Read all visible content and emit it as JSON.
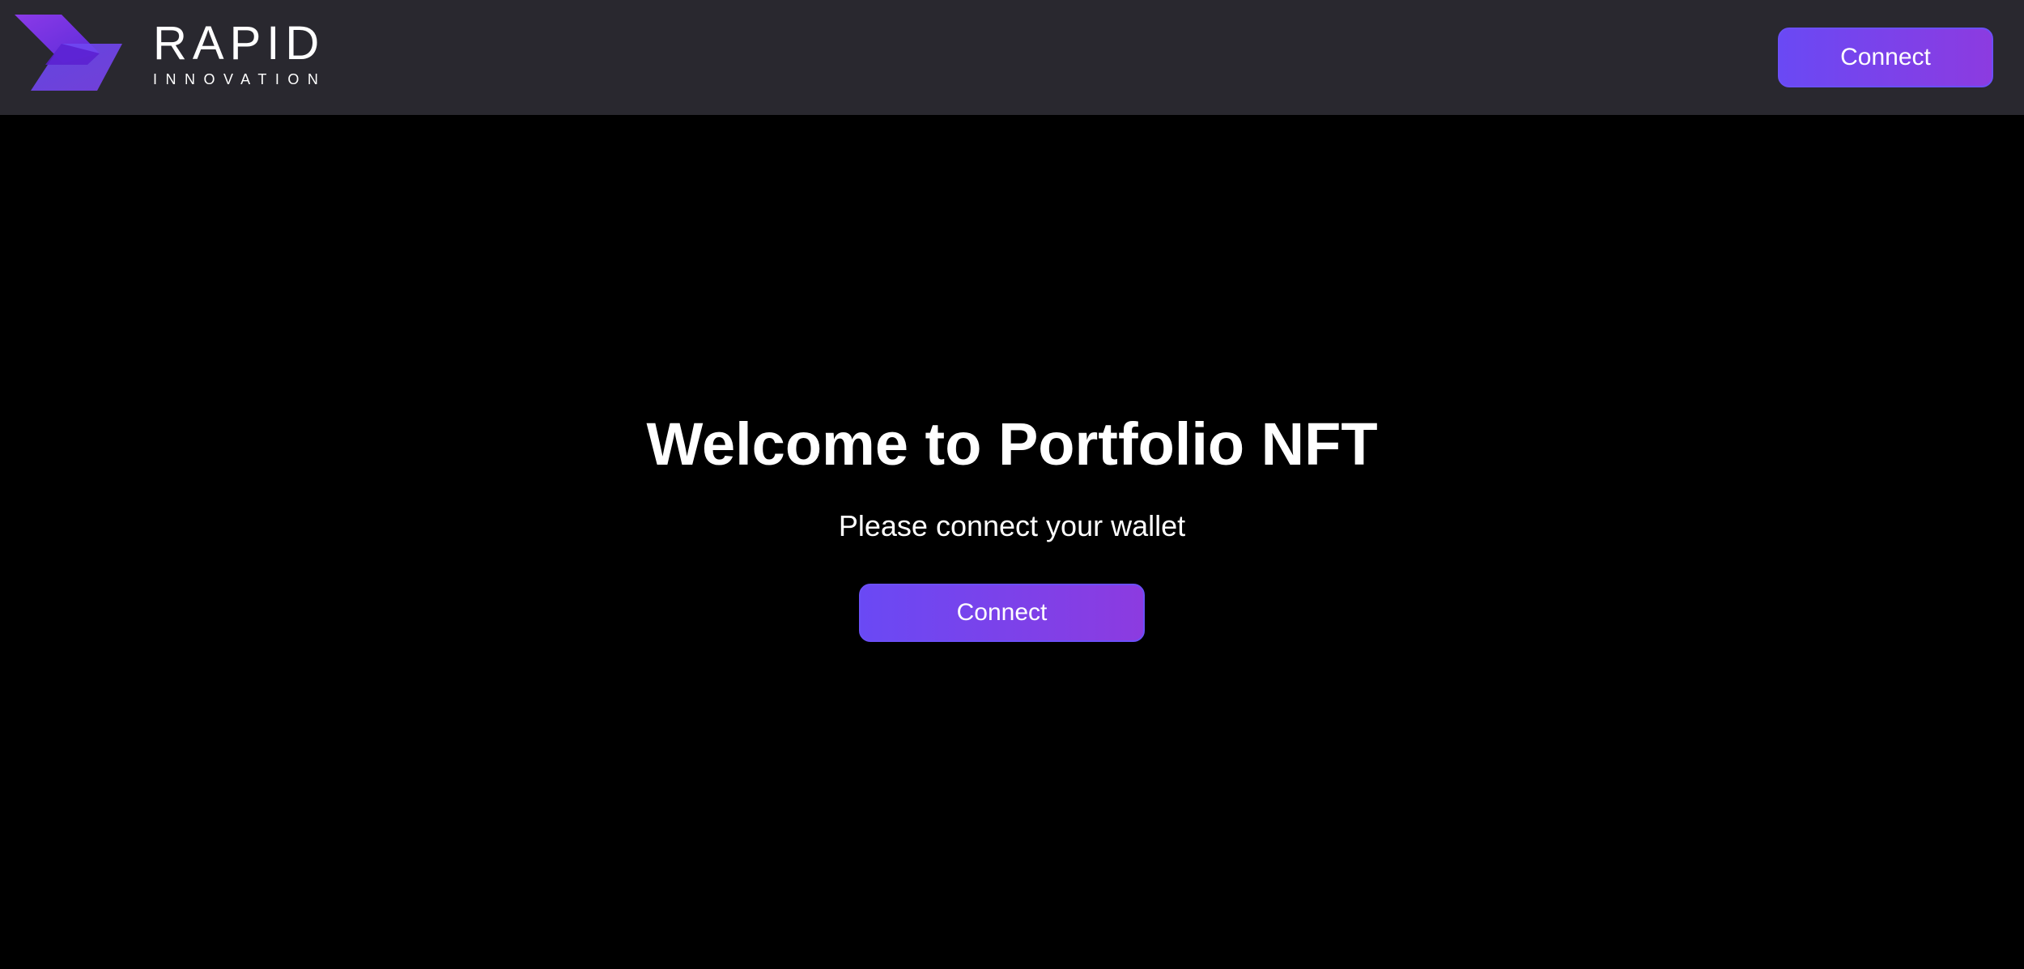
{
  "header": {
    "logo": {
      "title": "RAPID",
      "subtitle": "INNOVATION",
      "icon": "rapid-innovation-logo-icon"
    },
    "connect_label": "Connect"
  },
  "hero": {
    "title": "Welcome to Portfolio NFT",
    "subtitle": "Please connect your wallet",
    "connect_label": "Connect"
  },
  "colors": {
    "header_bg": "#29282f",
    "page_bg": "#000000",
    "accent_start": "#6a49f4",
    "accent_end": "#8c3be0"
  }
}
